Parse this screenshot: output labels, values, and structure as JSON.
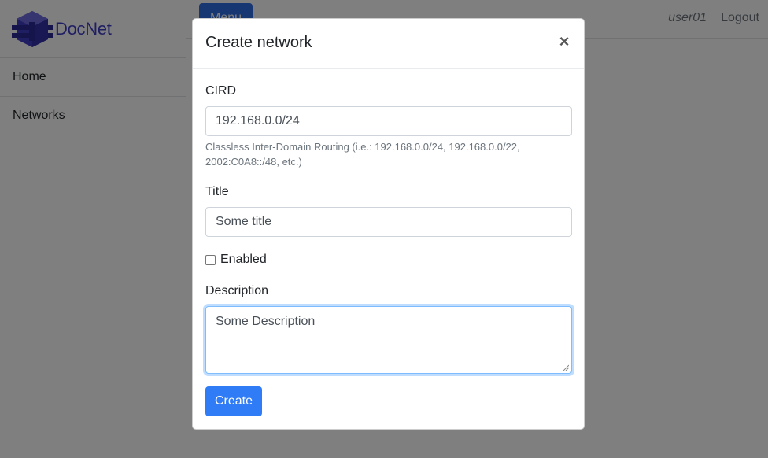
{
  "brand": {
    "name": "DocNet"
  },
  "sidebar": {
    "items": [
      {
        "label": "Home"
      },
      {
        "label": "Networks"
      }
    ]
  },
  "topbar": {
    "menu_label": "Menu",
    "user": "user01",
    "logout_label": "Logout"
  },
  "modal": {
    "title": "Create network",
    "close_glyph": "×",
    "cird": {
      "label": "CIRD",
      "value": "192.168.0.0/24",
      "help": "Classless Inter-Domain Routing (i.e.: 192.168.0.0/24, 192.168.0.0/22, 2002:C0A8::/48, etc.)"
    },
    "title_field": {
      "label": "Title",
      "value": "Some title"
    },
    "enabled": {
      "label": "Enabled",
      "checked": false
    },
    "description": {
      "label": "Description",
      "value": "Some Description"
    },
    "create_label": "Create"
  },
  "colors": {
    "brand": "#3f3dc7",
    "primary": "#2f7cf6",
    "backdrop": "rgba(0,0,0,0.5)"
  }
}
